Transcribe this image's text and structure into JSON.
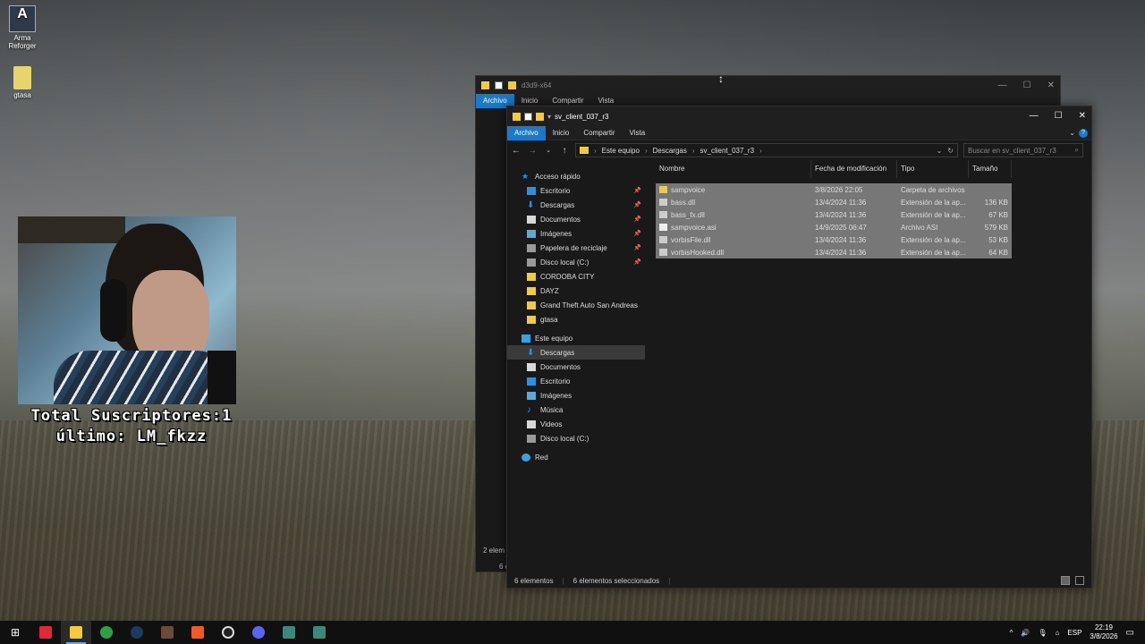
{
  "desktop": {
    "icons": [
      {
        "label": "Arma Reforger"
      },
      {
        "label": "gtasa"
      }
    ],
    "overlay": {
      "line1": "Total Suscriptores:1",
      "line2": "último: LM_fkzz"
    }
  },
  "back_window": {
    "title": "d3d9-x64",
    "tabs": [
      "Archivo",
      "Inicio",
      "Compartir",
      "Vista"
    ],
    "status": "2 elem",
    "status2": "6 e"
  },
  "window": {
    "title": "sv_client_037_r3",
    "tabs": [
      "Archivo",
      "Inicio",
      "Compartir",
      "Vista"
    ],
    "breadcrumb": [
      "Este equipo",
      "Descargas",
      "sv_client_037_r3"
    ],
    "search_placeholder": "Buscar en sv_client_037_r3",
    "nav": {
      "quick_access": "Acceso rápido",
      "quick_items": [
        "Escritorio",
        "Descargas",
        "Documentos",
        "Imágenes",
        "Papelera de reciclaje",
        "Disco local (C:)",
        "CORDOBA CITY",
        "DAYZ",
        "Grand Theft Auto San Andreas",
        "gtasa"
      ],
      "this_pc": "Este equipo",
      "pc_items": [
        "Descargas",
        "Documentos",
        "Escritorio",
        "Imágenes",
        "Música",
        "Videos",
        "Disco local (C:)"
      ],
      "network": "Red"
    },
    "columns": [
      "Nombre",
      "Fecha de modificación",
      "Tipo",
      "Tamaño"
    ],
    "files": [
      {
        "name": "sampvoice",
        "date": "3/8/2026 22:05",
        "type": "Carpeta de archivos",
        "size": "",
        "kind": "folder"
      },
      {
        "name": "bass.dll",
        "date": "13/4/2024 11:36",
        "type": "Extensión de la ap...",
        "size": "136 KB",
        "kind": "dll"
      },
      {
        "name": "bass_fx.dll",
        "date": "13/4/2024 11:36",
        "type": "Extensión de la ap...",
        "size": "67 KB",
        "kind": "dll"
      },
      {
        "name": "sampvoice.asi",
        "date": "14/9/2025 06:47",
        "type": "Archivo ASI",
        "size": "579 KB",
        "kind": "asi"
      },
      {
        "name": "vorbisFile.dll",
        "date": "13/4/2024 11:36",
        "type": "Extensión de la ap...",
        "size": "53 KB",
        "kind": "dll"
      },
      {
        "name": "vorbisHooked.dll",
        "date": "13/4/2024 11:36",
        "type": "Extensión de la ap...",
        "size": "64 KB",
        "kind": "dll"
      }
    ],
    "status_count": "6 elementos",
    "status_selected": "6 elementos seleccionados"
  },
  "taskbar": {
    "lang": "ESP",
    "time": "22:19",
    "date": "3/8/2026"
  }
}
